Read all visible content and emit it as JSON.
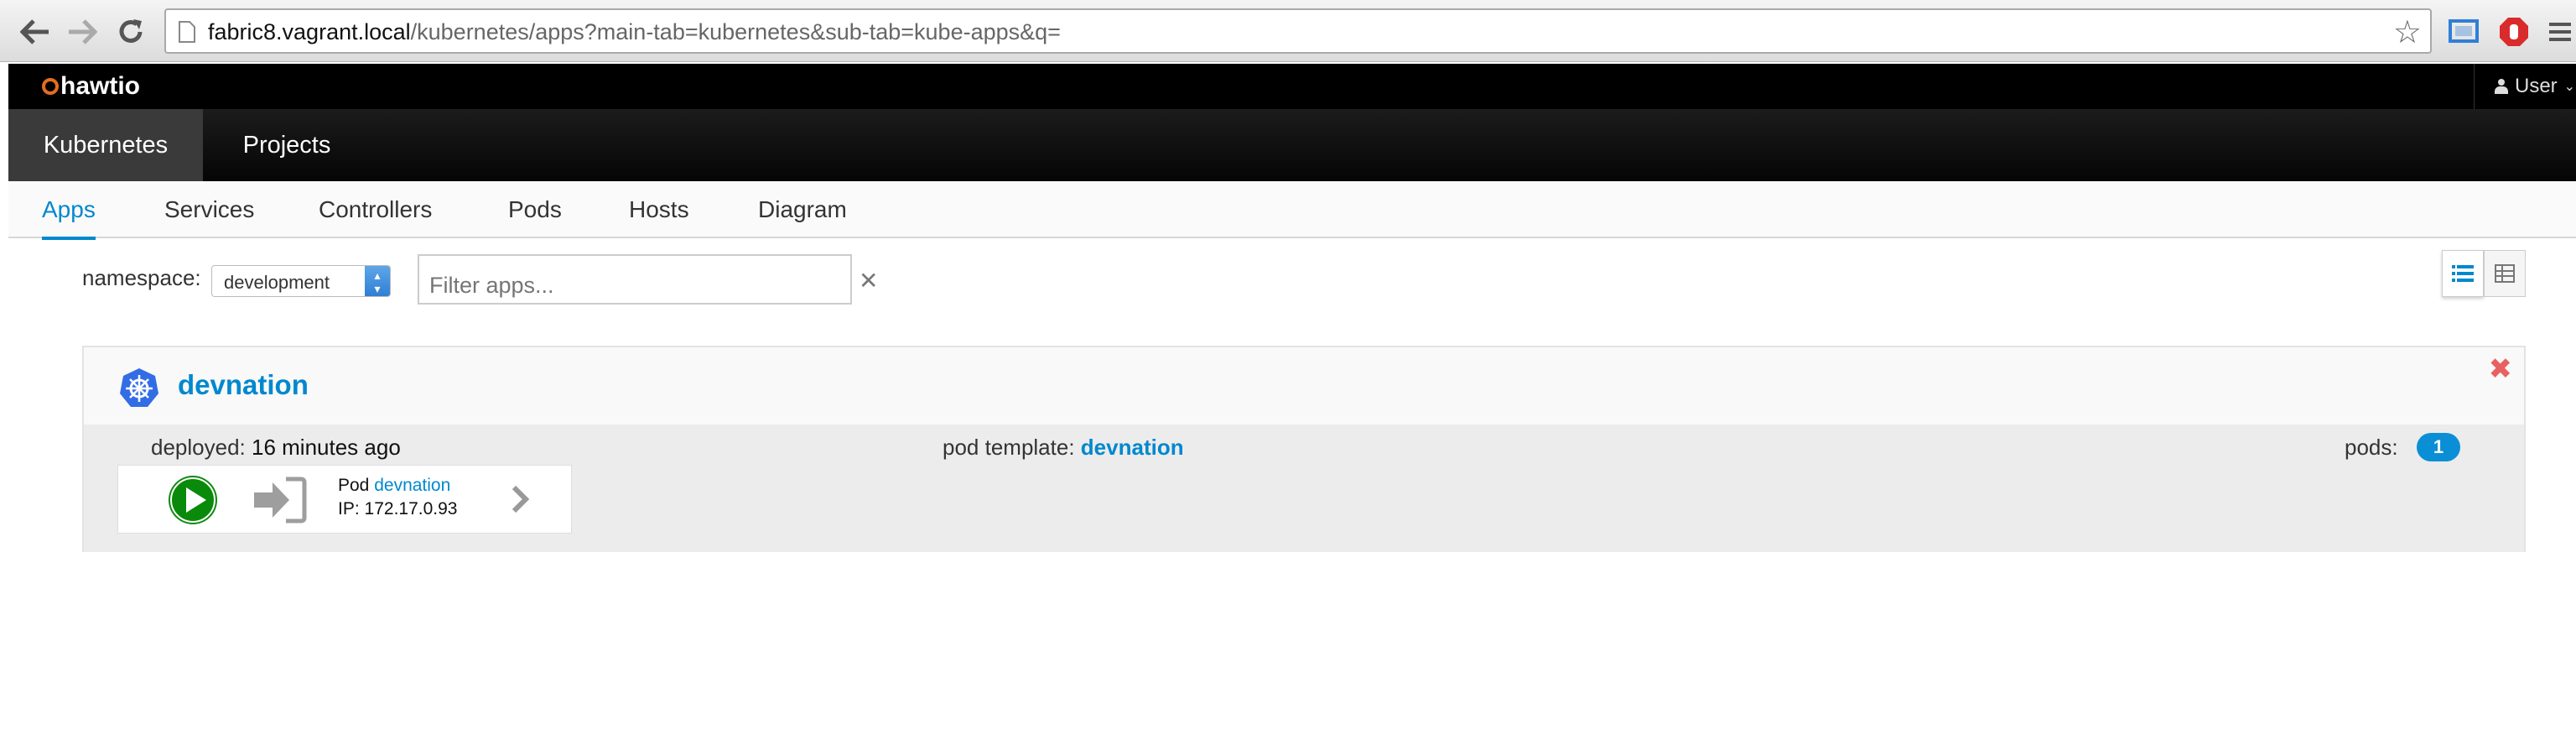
{
  "browser": {
    "url_host": "fabric8.vagrant.local",
    "url_path": "/kubernetes/apps?main-tab=kubernetes&sub-tab=kube-apps&q="
  },
  "header": {
    "logo": "hawtio",
    "user_label": "User"
  },
  "main_nav": {
    "tabs": [
      {
        "label": "Kubernetes",
        "active": true
      },
      {
        "label": "Projects",
        "active": false
      }
    ]
  },
  "sub_nav": {
    "tabs": [
      {
        "label": "Apps",
        "active": true
      },
      {
        "label": "Services",
        "active": false
      },
      {
        "label": "Controllers",
        "active": false
      },
      {
        "label": "Pods",
        "active": false
      },
      {
        "label": "Hosts",
        "active": false
      },
      {
        "label": "Diagram",
        "active": false
      }
    ]
  },
  "filters": {
    "namespace_label": "namespace:",
    "namespace_value": "development",
    "filter_placeholder": "Filter apps..."
  },
  "app": {
    "name": "devnation",
    "deployed_label": "deployed:",
    "deployed_value": "16 minutes ago",
    "pod_template_label": "pod template:",
    "pod_template_value": "devnation",
    "pods_label": "pods:",
    "pods_count": "1",
    "pod": {
      "prefix": "Pod",
      "name": "devnation",
      "ip_label": "IP:",
      "ip_value": "172.17.0.93"
    }
  },
  "colors": {
    "accent": "#0088ce",
    "running": "#0a8a0a",
    "close": "#e96060"
  }
}
